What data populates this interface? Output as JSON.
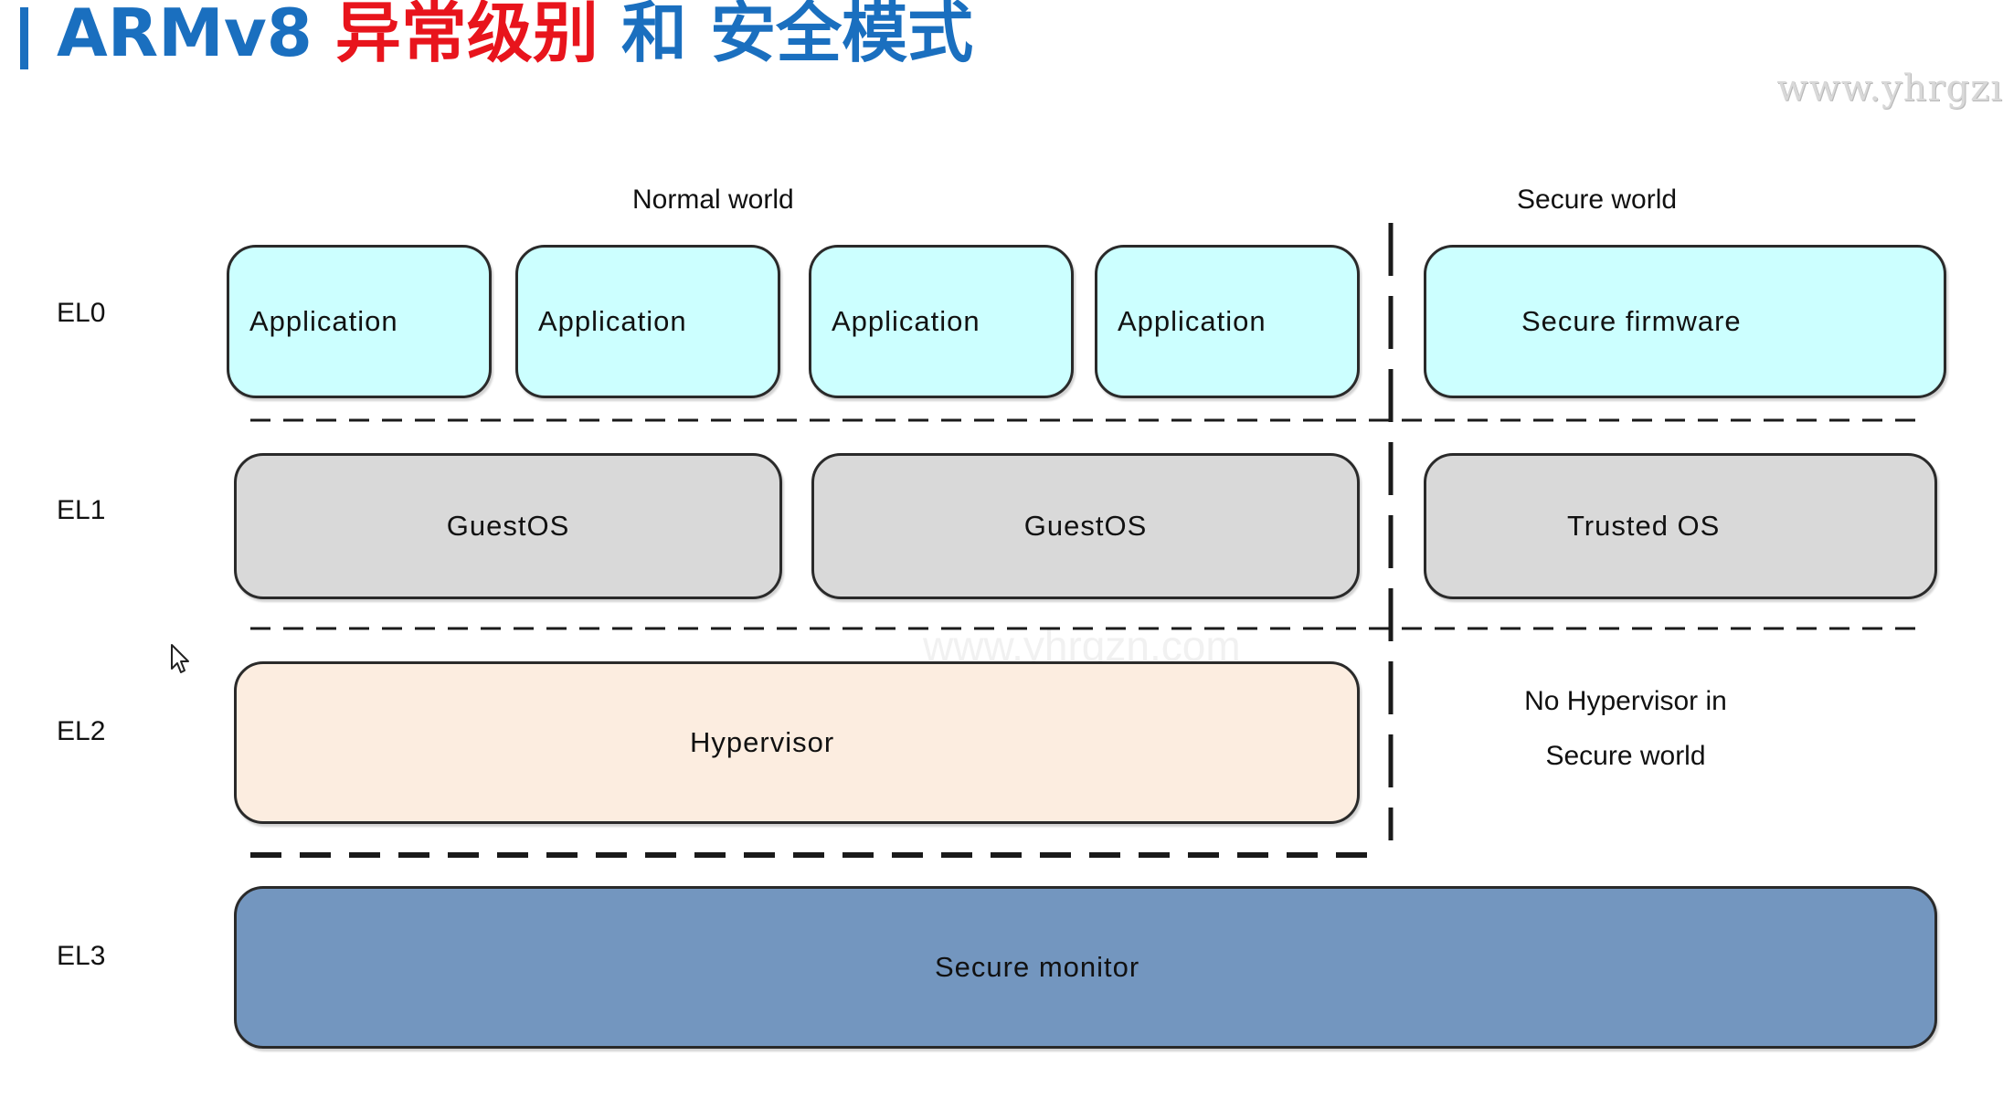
{
  "title": {
    "part1": "ARMv8",
    "part2": "异常级别",
    "part3": "和",
    "part4": "安全模式"
  },
  "watermarks": {
    "top_right": "www.yhrgzı",
    "center": "www.yhrgzn.com"
  },
  "worlds": {
    "normal": "Normal world",
    "secure": "Secure world"
  },
  "levels": {
    "el0": "EL0",
    "el1": "EL1",
    "el2": "EL2",
    "el3": "EL3"
  },
  "el0": {
    "applications": [
      "Application",
      "Application",
      "Application",
      "Application"
    ],
    "secure_firmware": "Secure firmware"
  },
  "el1": {
    "guest_os": [
      "GuestOS",
      "GuestOS"
    ],
    "trusted_os": "Trusted OS"
  },
  "el2": {
    "hypervisor": "Hypervisor",
    "no_hypervisor_line1": "No Hypervisor in",
    "no_hypervisor_line2": "Secure world"
  },
  "el3": {
    "secure_monitor": "Secure monitor"
  },
  "colors": {
    "title_blue": "#1a6fbf",
    "title_red": "#e8141c",
    "application": "#ccffff",
    "os": "#d9d9d9",
    "hypervisor": "#fcede0",
    "secure_monitor": "#7396bf"
  },
  "icons": {
    "cursor": "mouse-pointer-icon"
  }
}
